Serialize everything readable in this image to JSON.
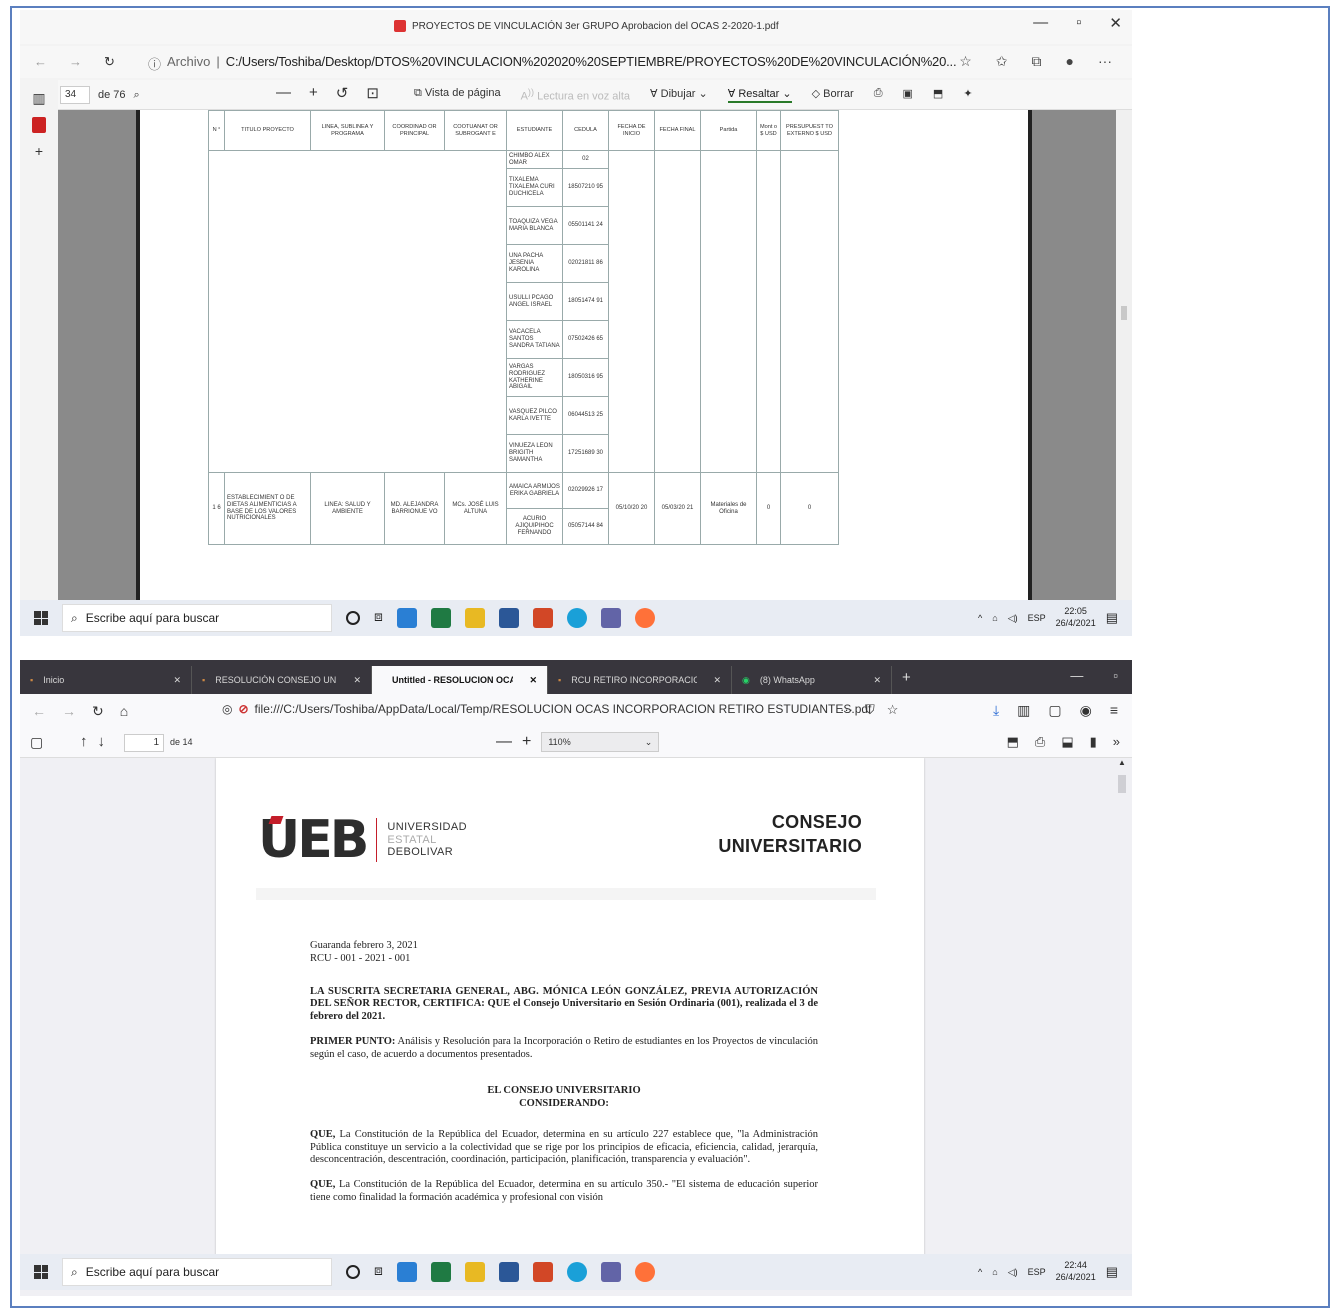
{
  "top": {
    "window_title": "PROYECTOS DE VINCULACIÓN 3er GRUPO Aprobacion del OCAS 2-2020-1.pdf",
    "address_label": "Archivo",
    "address_path": "C:/Users/Toshiba/Desktop/DTOS%20VINCULACION%202020%20SEPTIEMBRE/PROYECTOS%20DE%20VINCULACIÓN%20...",
    "page_current": "34",
    "page_total": "de 76",
    "toolbar": {
      "page_view": "Vista de página",
      "read_aloud": "Lectura en voz alta",
      "draw": "Dibujar",
      "highlight": "Resaltar",
      "erase": "Borrar"
    },
    "table": {
      "headers": [
        "N °",
        "TITULO PROYECTO",
        "LINEA, SUBLINEA Y PROGRAMA",
        "COORDINAD OR PRINCIPAL",
        "COOTUANAT OR SUBROGANT E",
        "ESTUDIANTE",
        "CEDULA",
        "FECHA DE INICIO",
        "FECHA FINAL",
        "Partida",
        "Mont o $ USD",
        "PRESUPUEST TO EXTERNO $ USD"
      ],
      "students_top": [
        {
          "name": "CHIMBO ALEX OMAR",
          "id": "02"
        },
        {
          "name": "TIXALEMA TIXALEMA CURI DUCHICELA",
          "id": "18507210 95"
        },
        {
          "name": "TOAQUIZA VEGA MARIA BLANCA",
          "id": "05501141 24"
        },
        {
          "name": "UNA PACHA JESENIA KAROLINA",
          "id": "02021811 86"
        },
        {
          "name": "USULLI PCAGO ANGEL ISRAEL",
          "id": "18051474 91"
        },
        {
          "name": "VACACELA SANTOS SANDRA TATIANA",
          "id": "07502426 65"
        },
        {
          "name": "VARGAS RODRIGUEZ KATHERINE ABIGAIL",
          "id": "18050316 95"
        },
        {
          "name": "VASQUEZ PILCO KARLA IVETTE",
          "id": "06044513 25"
        },
        {
          "name": "VINUEZA LEON BRIGITH SAMANTHA",
          "id": "17251689 30"
        }
      ],
      "project": {
        "number": "1 6",
        "title": "ESTABLECIMIENT O DE DIETAS ALIMENTICIAS A BASE DE LOS VALORES NUTRICIONALES",
        "line": "LINEA: SALUD Y AMBIENTE",
        "coordinator": "MD. ALEJANDRA BARRIONUE VO",
        "subrogant": "MCs. JOSÉ LUIS ALTUNA",
        "start": "05/10/20 20",
        "end": "05/03/20 21",
        "partida": "Materiales de Oficina",
        "monto": "0",
        "externo": "0",
        "students": [
          {
            "name": "AMAICA ARMIJOS ERIKA GABRIELA",
            "id": "02029926 17"
          },
          {
            "name": "ACURIO AJIQUIPIHOC FERNANDO",
            "id": "05057144 84"
          }
        ]
      }
    },
    "taskbar": {
      "search": "Escribe aquí para buscar",
      "lang": "ESP",
      "time": "22:05",
      "date": "26/4/2021"
    }
  },
  "bottom": {
    "tabs": [
      {
        "label": "Inicio",
        "active": false
      },
      {
        "label": "RESOLUCIÓN CONSEJO UNIV...",
        "active": false
      },
      {
        "label": "Untitled - RESOLUCION OCAS INC...",
        "active": true
      },
      {
        "label": "RCU RETIRO INCORPORACION A...",
        "active": false
      },
      {
        "label": "(8) WhatsApp",
        "active": false
      }
    ],
    "url": "file:///C:/Users/Toshiba/AppData/Local/Temp/RESOLUCION OCAS INCORPORACION RETIRO ESTUDIANTES.pdf",
    "page_current": "1",
    "page_total": "de 14",
    "zoom": "110%",
    "document": {
      "logo_main": "UEB",
      "logo_line1": "UNIVERSIDAD",
      "logo_line2": "ESTATAL",
      "logo_line3": "DEBOLIVAR",
      "header_right_1": "CONSEJO",
      "header_right_2": "UNIVERSITARIO",
      "date": "Guaranda febrero 3, 2021",
      "ref": "RCU - 001 - 2021 - 001",
      "para1": "LA SUSCRITA SECRETARIA GENERAL, ABG. MÓNICA LEÓN GONZÁLEZ, PREVIA AUTORIZACIÓN DEL SEÑOR RECTOR, CERTIFICA: QUE el Consejo Universitario en Sesión Ordinaria (001), realizada el 3 de febrero del 2021.",
      "para2_bold": "PRIMER PUNTO:",
      "para2": " Análisis y Resolución para la Incorporación o Retiro de estudiantes en los Proyectos de vinculación según el caso, de acuerdo a documentos presentados.",
      "heading1": "EL CONSEJO UNIVERSITARIO",
      "heading2": "CONSIDERANDO:",
      "para3_bold": "QUE,",
      "para3": " La Constitución de la República del Ecuador, determina en su artículo 227 establece que, \"la Administración Pública constituye un servicio a la colectividad que se rige por los principios de eficacia, eficiencia, calidad, jerarquía, desconcentración, descentración, coordinación, participación, planificación, transparencia y evaluación\".",
      "para4_bold": "QUE,",
      "para4": " La Constitución de la República del Ecuador, determina en su artículo 350.- \"El sistema de educación superior tiene como finalidad la formación académica y profesional con visión"
    },
    "taskbar": {
      "search": "Escribe aquí para buscar",
      "lang": "ESP",
      "time": "22:44",
      "date": "26/4/2021"
    }
  }
}
